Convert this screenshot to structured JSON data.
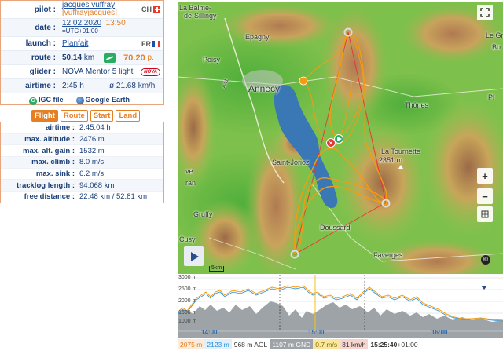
{
  "flight": {
    "pilot_label": "pilot :",
    "pilot_name": "jacques vuffray",
    "pilot_user": "[vuffrayjacques]",
    "pilot_country": "CH",
    "date_label": "date :",
    "date": "12.02.2020",
    "time": "13:50",
    "timezone": "=UTC+01:00",
    "launch_label": "launch :",
    "launch": "Planfait",
    "launch_country": "FR",
    "route_label": "route :",
    "route_km": "50.14",
    "route_km_unit": "km",
    "route_points": "70.20",
    "route_points_unit": "p.",
    "glider_label": "glider :",
    "glider": "NOVA Mentor 5 light",
    "glider_brand_badge": "NOVA",
    "airtime_label": "airtime :",
    "airtime": "2:45 h",
    "speed": "ø 21.68 km/h",
    "igc_label": "IGC file",
    "ge_label": "Google Earth"
  },
  "tabs": [
    "Flight",
    "Route",
    "Start",
    "Land"
  ],
  "stats": [
    {
      "label": "airtime :",
      "value": "2:45:04 h"
    },
    {
      "label": "max. altitude :",
      "value": "2476 m"
    },
    {
      "label": "max. alt. gain :",
      "value": "1532 m"
    },
    {
      "label": "max. climb :",
      "value": "8.0 m/s"
    },
    {
      "label": "max. sink :",
      "value": "6.2 m/s"
    },
    {
      "label": "tracklog length :",
      "value": "94.068 km"
    },
    {
      "label": "free distance :",
      "value": "22.48 km / 52.81 km"
    }
  ],
  "map": {
    "labels": {
      "la_balme": "La Balme-",
      "de_sillingy": "de-Sillingy",
      "epagny": "Epagny",
      "poisy": "Poisy",
      "annecy": "Annecy",
      "thones": "Thônes",
      "la_tournette": "La Tournette",
      "la_tournette_alt": "2351 m",
      "saint_jorioz": "Saint-Jorioz",
      "doussard": "Doussard",
      "faverges": "Faverges",
      "gruffy": "Gruffy",
      "cusy": "Cusy",
      "le_gr": "Le Gr",
      "bo": "Bo",
      "a41": "A41",
      "p1": "Pl",
      "sillingy_left": "lé",
      "s_left": "s",
      "ann_left": "l'Ann",
      "sevrier_a": "ve",
      "sevrier_b": "ran"
    },
    "scale": "5km",
    "zoom_in": "+",
    "zoom_out": "−",
    "colors": {
      "track": "#f39c12",
      "triangle": "#e53935",
      "lake": "#3a78b5"
    }
  },
  "chart": {
    "y_ticks": [
      "3000 m",
      "2500 m",
      "2000 m",
      "1500 m",
      "1000 m"
    ],
    "x_ticks": [
      "14:00",
      "15:00",
      "16:00"
    ]
  },
  "status": {
    "alt": "2075 m",
    "alt2": "2123 m",
    "agl": "968 m AGL",
    "gnd": "1107 m GND",
    "vario": "0.7 m/s",
    "speed": "31 km/h",
    "time": "15:25:40",
    "tz": "+01:00"
  }
}
